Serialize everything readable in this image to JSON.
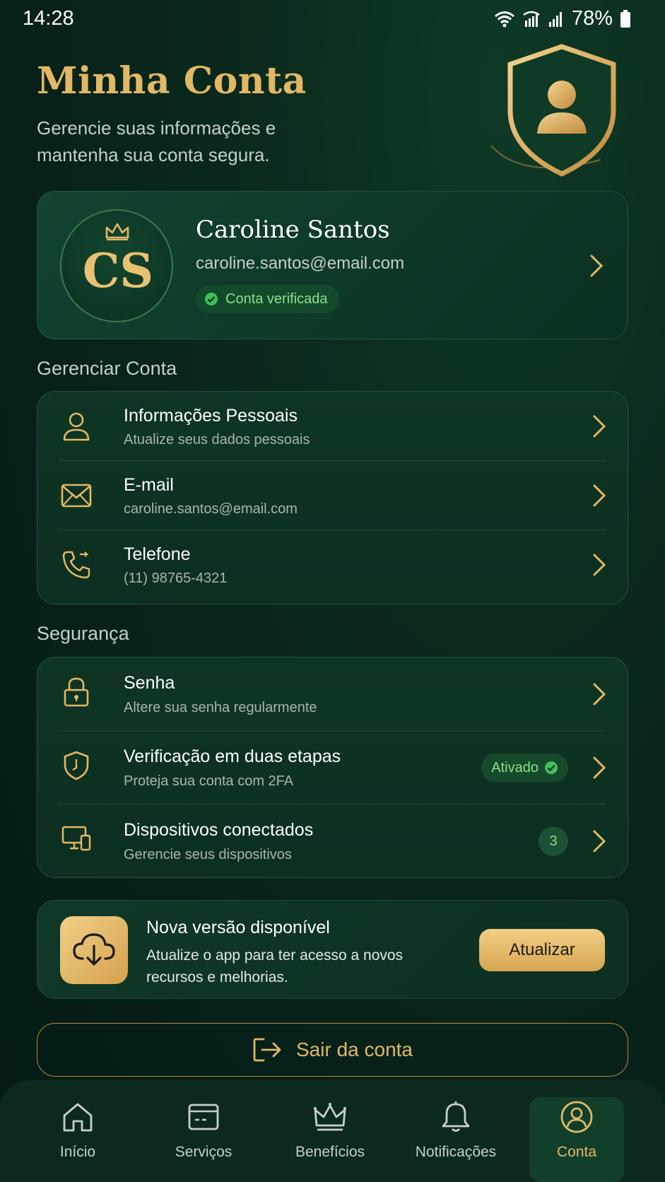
{
  "status_bar": {
    "time": "14:28",
    "battery": "78%",
    "icons": [
      "wifi-icon",
      "signal-icon",
      "cell-signal-icon",
      "battery-icon"
    ]
  },
  "header": {
    "title": "Minha Conta",
    "subtitle": "Gerencie suas informações e mantenha sua conta segura.",
    "illustration": "shield-user-icon"
  },
  "profile": {
    "initials": "CS",
    "name": "Caroline Santos",
    "email": "caroline.santos@email.com",
    "verified_label": "Conta verificada"
  },
  "manage": {
    "section_title": "Gerenciar Conta",
    "items": [
      {
        "icon": "user-icon",
        "title": "Informações Pessoais",
        "subtitle": "Atualize seus dados pessoais"
      },
      {
        "icon": "mail-icon",
        "title": "E-mail",
        "subtitle": "caroline.santos@email.com"
      },
      {
        "icon": "phone-icon",
        "title": "Telefone",
        "subtitle": "(11) 98765-4321"
      }
    ]
  },
  "security": {
    "section_title": "Segurança",
    "items": [
      {
        "icon": "lock-icon",
        "title": "Senha",
        "subtitle": "Altere sua senha regularmente"
      },
      {
        "icon": "shield-check-icon",
        "title": "Verificação em duas etapas",
        "subtitle": "Proteja sua conta com 2FA",
        "status": "Ativado"
      },
      {
        "icon": "devices-icon",
        "title": "Dispositivos conectados",
        "subtitle": "Gerencie seus dispositivos",
        "count": "3"
      }
    ]
  },
  "update": {
    "title": "Nova versão disponível",
    "description": "Atualize o app para ter acesso a novos recursos e melhorias.",
    "button": "Atualizar",
    "icon": "cloud-download-icon"
  },
  "logout": {
    "label": "Sair da conta",
    "icon": "logout-icon"
  },
  "bottom_nav": {
    "items": [
      {
        "label": "Início",
        "icon": "home-icon"
      },
      {
        "label": "Serviços",
        "icon": "card-icon"
      },
      {
        "label": "Benefícios",
        "icon": "crown-icon"
      },
      {
        "label": "Notificações",
        "icon": "bell-icon"
      },
      {
        "label": "Conta",
        "icon": "account-icon",
        "active": true
      }
    ]
  },
  "colors": {
    "accent_gold": "#e2b865",
    "success_green": "#8be08a",
    "background": "#07201a"
  }
}
